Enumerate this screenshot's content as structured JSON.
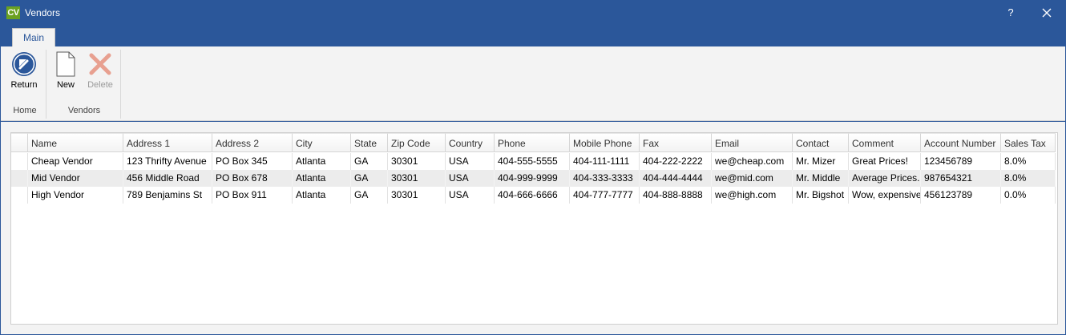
{
  "window": {
    "app_icon_text": "CV",
    "title": "Vendors",
    "help_label": "?"
  },
  "ribbon": {
    "tabs": [
      {
        "label": "Main",
        "active": true
      }
    ],
    "groups": [
      {
        "label": "Home",
        "buttons": [
          {
            "label": "Return",
            "icon": "return-arrow-icon",
            "enabled": true
          }
        ]
      },
      {
        "label": "Vendors",
        "buttons": [
          {
            "label": "New",
            "icon": "new-document-icon",
            "enabled": true
          },
          {
            "label": "Delete",
            "icon": "delete-x-icon",
            "enabled": false
          }
        ]
      }
    ]
  },
  "grid": {
    "columns": [
      "Name",
      "Address 1",
      "Address 2",
      "City",
      "State",
      "Zip Code",
      "Country",
      "Phone",
      "Mobile Phone",
      "Fax",
      "Email",
      "Contact",
      "Comment",
      "Account Number",
      "Sales Tax"
    ],
    "rows": [
      [
        "Cheap Vendor",
        "123 Thrifty Avenue",
        "PO Box 345",
        "Atlanta",
        "GA",
        "30301",
        "USA",
        "404-555-5555",
        "404-111-1111",
        "404-222-2222",
        "we@cheap.com",
        "Mr. Mizer",
        "Great Prices!",
        "123456789",
        "8.0%"
      ],
      [
        "Mid Vendor",
        "456 Middle Road",
        "PO Box 678",
        "Atlanta",
        "GA",
        "30301",
        "USA",
        "404-999-9999",
        "404-333-3333",
        "404-444-4444",
        "we@mid.com",
        "Mr. Middle",
        "Average Prices.",
        "987654321",
        "8.0%"
      ],
      [
        "High Vendor",
        "789 Benjamins St",
        "PO Box 911",
        "Atlanta",
        "GA",
        "30301",
        "USA",
        "404-666-6666",
        "404-777-7777",
        "404-888-8888",
        "we@high.com",
        "Mr. Bigshot",
        "Wow, expensive",
        "456123789",
        "0.0%"
      ]
    ]
  },
  "colors": {
    "title_bar": "#2b579a",
    "ribbon_bg": "#f3f3f3",
    "app_icon": "#6aa121",
    "return_icon": "#2b579a",
    "delete_icon": "#e8a090"
  }
}
